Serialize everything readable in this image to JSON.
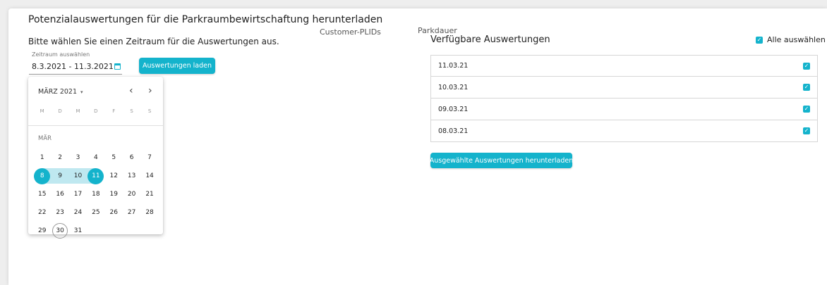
{
  "page": {
    "title": "Potenzialauswertungen für die Parkraumbewirtschaftung herunterladen",
    "instruction": "Bitte wählen Sie einen Zeitraum für die Auswertungen aus.",
    "tabs": [
      "Customer-PLIDs",
      "Parkdauer"
    ]
  },
  "range": {
    "label": "Zeitraum auswählen",
    "value": "8.3.2021 - 11.3.2021",
    "icon": "calendar-icon",
    "load_button": "Auswertungen laden"
  },
  "calendar": {
    "month_label": "MÄRZ 2021",
    "caret": "▾",
    "prev": "‹",
    "next": "›",
    "weekdays": [
      "M",
      "D",
      "M",
      "D",
      "F",
      "S",
      "S"
    ],
    "section_label": "MÄR",
    "weeks": [
      [
        "1",
        "2",
        "3",
        "4",
        "5",
        "6",
        "7"
      ],
      [
        "8",
        "9",
        "10",
        "11",
        "12",
        "13",
        "14"
      ],
      [
        "15",
        "16",
        "17",
        "18",
        "19",
        "20",
        "21"
      ],
      [
        "22",
        "23",
        "24",
        "25",
        "26",
        "27",
        "28"
      ],
      [
        "29",
        "30",
        "31"
      ]
    ],
    "selected_start": "8",
    "selected_end": "11",
    "today": "30"
  },
  "reports": {
    "title": "Verfügbare Auswertungen",
    "select_all_label": "Alle auswählen",
    "select_all_checked": true,
    "items": [
      {
        "date": "11.03.21",
        "checked": true
      },
      {
        "date": "10.03.21",
        "checked": true
      },
      {
        "date": "09.03.21",
        "checked": true
      },
      {
        "date": "08.03.21",
        "checked": true
      }
    ],
    "download_button": "Ausgewählte Auswertungen herunterladen"
  },
  "colors": {
    "accent": "#14b3cc",
    "range_band": "#bfe8f0"
  }
}
